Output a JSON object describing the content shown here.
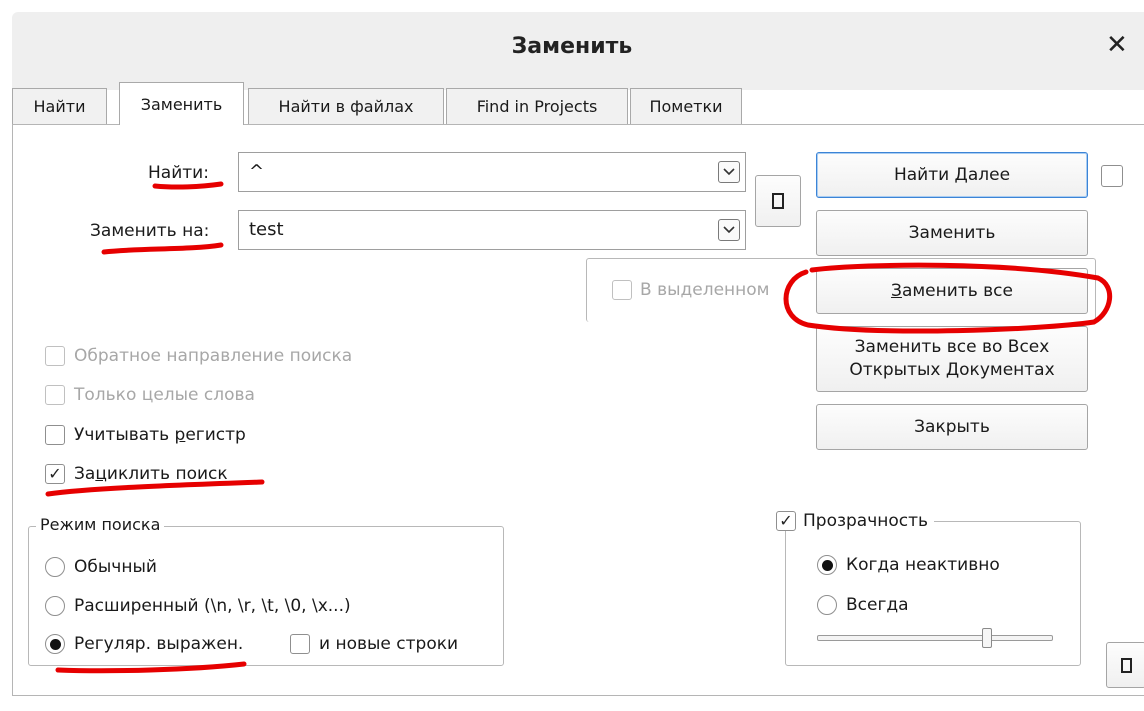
{
  "window": {
    "title": "Заменить",
    "close_glyph": "✕"
  },
  "tabs": [
    {
      "label": "Найти",
      "active": false
    },
    {
      "label": "Заменить",
      "active": true
    },
    {
      "label": "Найти в файлах",
      "active": false
    },
    {
      "label": "Find in Projects",
      "active": false
    },
    {
      "label": "Пометки",
      "active": false
    }
  ],
  "find": {
    "label": "Найти:",
    "value": "^"
  },
  "replace": {
    "label": "Заменить на:",
    "value": "test"
  },
  "in_selection": {
    "label": "В выделенном",
    "checked": false,
    "enabled": false
  },
  "buttons": {
    "find_next": "Найти Далее",
    "replace": "Заменить",
    "replace_all_pre": "З",
    "replace_all_post": "аменить все",
    "replace_all_open_line1": "Заменить все во Всех",
    "replace_all_open_line2_pre": "Открытых ",
    "replace_all_open_line2_u": "Д",
    "replace_all_open_line2_post": "окументах",
    "close": "Закрыть"
  },
  "options": {
    "backward": {
      "label": "Обратное направление поиска",
      "checked": false,
      "enabled": false
    },
    "whole_word": {
      "label": "Только целые слова",
      "checked": false,
      "enabled": false
    },
    "match_case_pre": "Учитывать ",
    "match_case_u": "р",
    "match_case_post": "егистр",
    "match_case_checked": false,
    "wrap_pre": "За",
    "wrap_u": "ц",
    "wrap_post": "иклить поиск",
    "wrap_checked": true
  },
  "search_mode": {
    "title": "Режим поиска",
    "normal": "Обычный",
    "extended": "Расширенный (\\n, \\r, \\t, \\0, \\x...)",
    "regex": "Регуляр. выражен.",
    "selected": "regex",
    "newlines_label": "и новые строки",
    "newlines_checked": false
  },
  "transparency": {
    "label": "Прозрачность",
    "checked": true,
    "when_inactive": "Когда неактивно",
    "always": "Всегда",
    "selected": "when_inactive",
    "slider_level": 0.73
  },
  "check_glyph": "✓",
  "annotation_color": "#e60000"
}
